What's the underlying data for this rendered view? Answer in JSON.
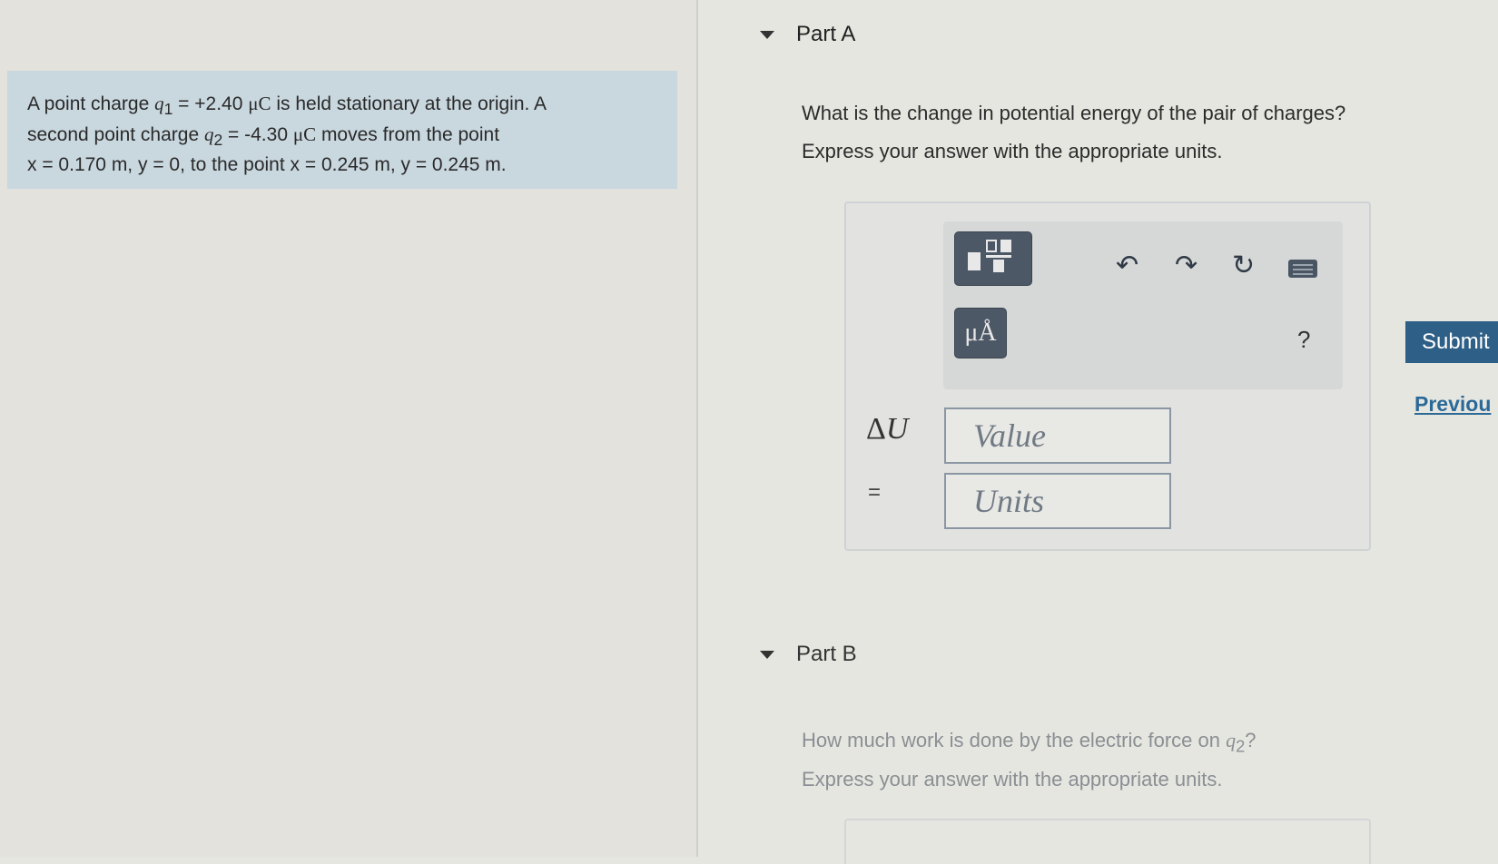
{
  "problem": {
    "line1_pre": "A point charge ",
    "q1_symbol": "q",
    "q1_sub": "1",
    "q1_value": " = +2.40 ",
    "q1_unit": "μC",
    "line1_post": " is held stationary at the origin. A",
    "line2_pre": "second point charge ",
    "q2_symbol": "q",
    "q2_sub": "2",
    "q2_value": " = -4.30 ",
    "q2_unit": "μC",
    "line2_post": " moves from the point",
    "line3": "x = 0.170 m, y = 0, to the point x = 0.245 m, y = 0.245 m."
  },
  "part_a": {
    "title": "Part A",
    "question": "What is the change in potential energy of the pair of charges?",
    "instruction": "Express your answer with the appropriate units.",
    "toolbar": {
      "units_button_label": "μÅ",
      "help_label": "?"
    },
    "variable_symbol": "U",
    "variable_delta": "Δ",
    "equals": "=",
    "value_placeholder": "Value",
    "units_placeholder": "Units"
  },
  "submit_label": "Submit",
  "previous_label": "Previou",
  "part_b": {
    "title": "Part B",
    "question_pre": "How much work is done by the electric force on ",
    "question_symbol": "q",
    "question_sub": "2",
    "question_post": "?",
    "instruction": "Express your answer with the appropriate units."
  }
}
